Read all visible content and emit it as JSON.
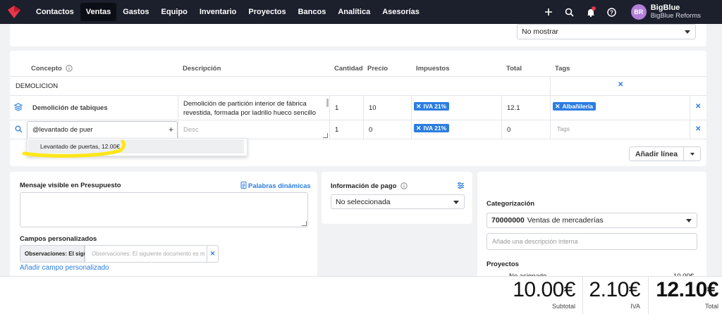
{
  "nav": {
    "items": [
      "Contactos",
      "Ventas",
      "Gastos",
      "Equipo",
      "Inventario",
      "Proyectos",
      "Bancos",
      "Analítica",
      "Asesorías"
    ],
    "active": "Ventas",
    "icons": [
      "plus-icon",
      "search-icon",
      "bell-icon",
      "help-icon"
    ],
    "user": {
      "initials": "BR",
      "name": "BigBlue",
      "company": "BigBlue Reforms"
    }
  },
  "top_select": {
    "value": "No mostrar"
  },
  "table": {
    "headers": {
      "concepto": "Concepto",
      "descripcion": "Descripción",
      "cantidad": "Cantidad",
      "precio": "Precio",
      "impuestos": "Impuestos",
      "total": "Total",
      "tags": "Tags"
    },
    "section_row": "DEMOLICION",
    "row1": {
      "concepto": "Demolición de tabiques",
      "descripcion": "Demolición de partición interior de fábrica revestida, formada por ladrillo hueco sencillo de",
      "cantidad": "1",
      "precio": "10",
      "impuesto": "IVA 21%",
      "total": "12.1",
      "tag": "Albañilería"
    },
    "row2": {
      "concepto": "@levantado de puer",
      "descripcion_placeholder": "Desc",
      "cantidad": "1",
      "precio": "0",
      "impuesto": "IVA 21%",
      "total": "0",
      "tags_placeholder": "Tags"
    },
    "suggestion": "Levantado de puertas, 12.00€",
    "add_line": "Añadir línea"
  },
  "message": {
    "title": "Mensaje visible en Presupuesto",
    "dynamic_words": "Palabras dinámicas",
    "custom_fields_title": "Campos personalizados",
    "custom_field_label": "Observaciones: El sigu",
    "custom_field_placeholder": "Observaciones: El siguiente documento es me",
    "add_custom_field": "Añadir campo personalizado"
  },
  "payment": {
    "title": "Información de pago",
    "value": "No seleccionada"
  },
  "categorization": {
    "title": "Categorización",
    "account": "70000000",
    "account_name": "Ventas de mercaderías",
    "internal_placeholder": "Añade una descripción interna",
    "projects_title": "Proyectos",
    "projects_partial_left": "No asignado",
    "projects_partial_right": "10.00€"
  },
  "totals": {
    "subtotal": "10.00€",
    "subtotal_label": "Subtotal",
    "iva": "2.10€",
    "iva_label": "IVA",
    "total": "12.10€",
    "total_label": "Total"
  },
  "colors": {
    "accent": "#2b7de1",
    "nav_bg": "#1c1f2c",
    "brand": "#e5364a",
    "highlight": "#ffe600"
  }
}
